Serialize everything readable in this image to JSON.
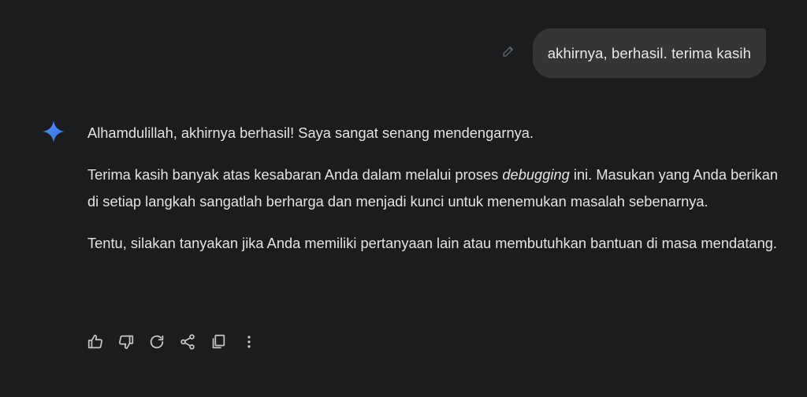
{
  "user_message": {
    "text": "akhirnya, berhasil. terima kasih"
  },
  "response": {
    "p1": "Alhamdulillah, akhirnya berhasil! Saya sangat senang mendengarnya.",
    "p2_before": "Terima kasih banyak atas kesabaran Anda dalam melalui proses ",
    "p2_em": "debugging",
    "p2_after": " ini. Masukan yang Anda berikan di setiap langkah sangatlah berharga dan menjadi kunci untuk menemukan masalah sebenarnya.",
    "p3": "Tentu, silakan tanyakan jika Anda memiliki pertanyaan lain atau membutuhkan bantuan di masa mendatang."
  },
  "icons": {
    "edit": "pencil-icon",
    "assistant": "sparkle-icon",
    "actions": [
      "thumbs-up-icon",
      "thumbs-down-icon",
      "regenerate-icon",
      "share-icon",
      "copy-icon",
      "more-vert-icon"
    ]
  },
  "colors": {
    "background": "#1b1c1d",
    "bubble": "#333537",
    "text": "#e3e3e3",
    "icon": "#c4c7c5",
    "sparkle": "#4f8ff7"
  }
}
